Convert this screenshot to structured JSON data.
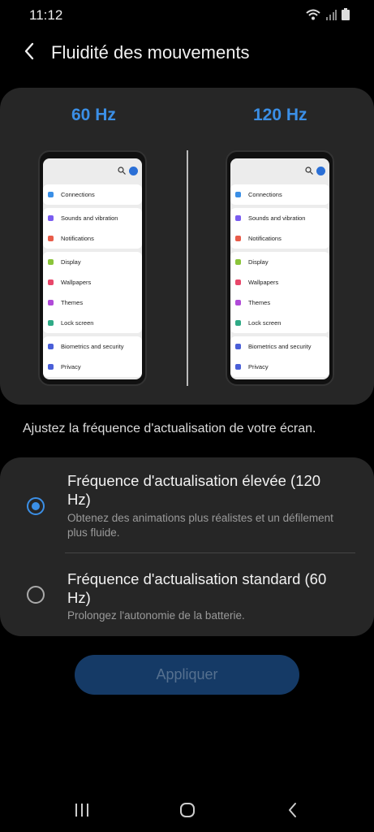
{
  "status": {
    "time": "11:12"
  },
  "header": {
    "title": "Fluidité des mouvements"
  },
  "preview": {
    "left_label": "60 Hz",
    "right_label": "120 Hz",
    "items": [
      {
        "label": "Connections",
        "icon": "wifi-icon",
        "color": "#3b8fe6"
      },
      {
        "label": "Sounds and vibration",
        "icon": "speaker-icon",
        "color": "#7a5cf0"
      },
      {
        "label": "Notifications",
        "icon": "bell-icon",
        "color": "#e85c4a"
      },
      {
        "label": "Display",
        "icon": "sun-icon",
        "color": "#8ac43a"
      },
      {
        "label": "Wallpapers",
        "icon": "picture-icon",
        "color": "#e8476a"
      },
      {
        "label": "Themes",
        "icon": "brush-icon",
        "color": "#b04ad8"
      },
      {
        "label": "Lock screen",
        "icon": "lock-icon",
        "color": "#2faa86"
      },
      {
        "label": "Biometrics and security",
        "icon": "shield-icon",
        "color": "#4a5fd8"
      },
      {
        "label": "Privacy",
        "icon": "privacy-icon",
        "color": "#4a5fd8"
      }
    ]
  },
  "description": "Ajustez la fréquence d'actualisation de votre écran.",
  "options": [
    {
      "title": "Fréquence d'actualisation élevée (120 Hz)",
      "subtitle": "Obtenez des animations plus réalistes et un défilement plus fluide.",
      "selected": true
    },
    {
      "title": "Fréquence d'actualisation standard (60 Hz)",
      "subtitle": "Prolongez l'autonomie de la batterie.",
      "selected": false
    }
  ],
  "apply_label": "Appliquer",
  "colors": {
    "accent": "#3b8fe6",
    "background": "#000000",
    "card": "#262626"
  }
}
